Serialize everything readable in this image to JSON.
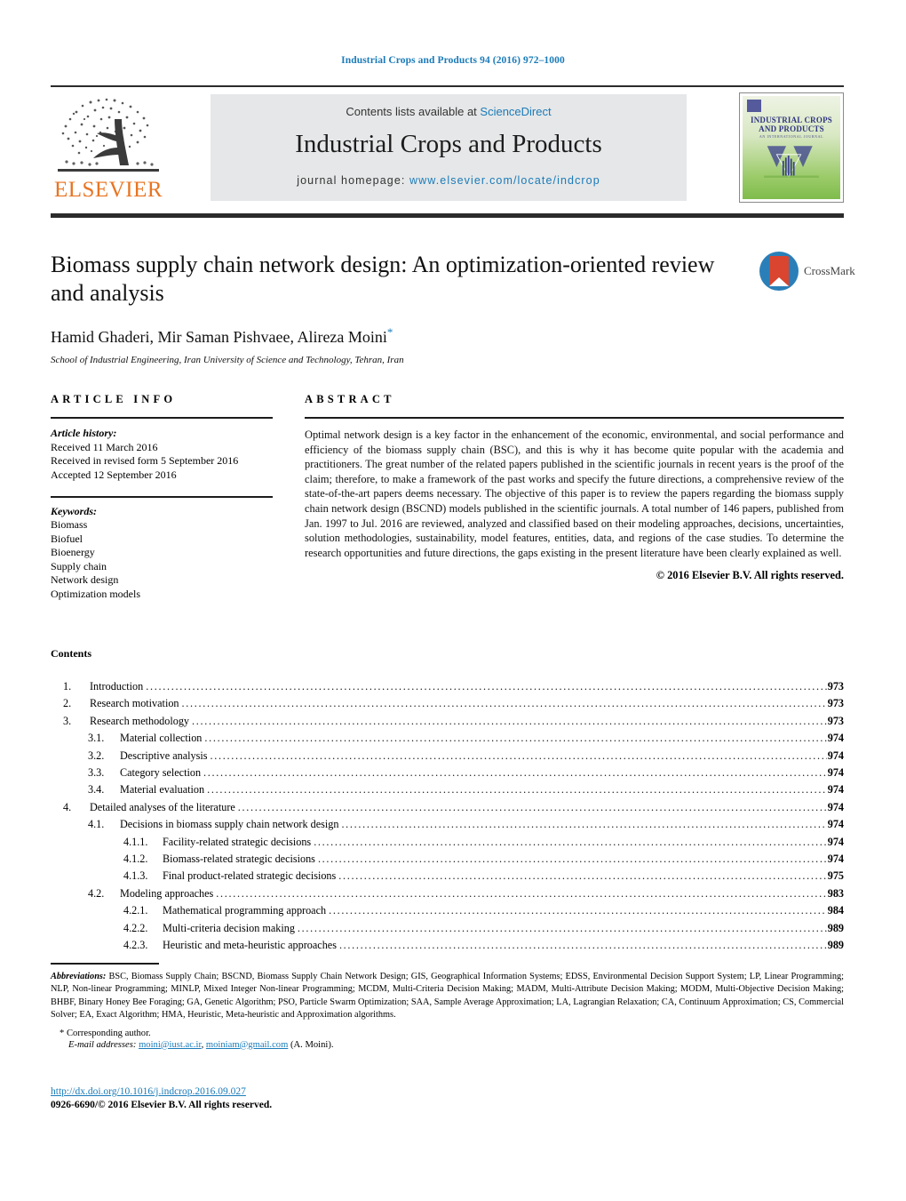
{
  "running_head": "Industrial Crops and Products 94 (2016) 972–1000",
  "masthead": {
    "publisher_name": "ELSEVIER",
    "contents_prefix": "Contents lists available at ",
    "sciencedirect": "ScienceDirect",
    "journal_title": "Industrial Crops and Products",
    "homepage_prefix": "journal homepage: ",
    "homepage_url": "www.elsevier.com/locate/indcrop",
    "cover": {
      "title_line1": "INDUSTRIAL CROPS",
      "title_line2": "AND PRODUCTS",
      "subtitle": "AN INTERNATIONAL JOURNAL"
    },
    "link_color": "#1a7bb9",
    "band_color": "#e6e7e8",
    "elsevier_orange": "#e87422"
  },
  "article": {
    "title": "Biomass supply chain network design: An optimization-oriented review and analysis",
    "authors": "Hamid Ghaderi, Mir Saman Pishvaee, Alireza Moini",
    "corresponding_marker": "*",
    "affiliation": "School of Industrial Engineering, Iran University of Science and Technology, Tehran, Iran",
    "crossmark_label": "CrossMark"
  },
  "article_info": {
    "heading": "ARTICLE INFO",
    "history_label": "Article history:",
    "history": [
      "Received 11 March 2016",
      "Received in revised form 5 September 2016",
      "Accepted 12 September 2016"
    ],
    "keywords_label": "Keywords:",
    "keywords": [
      "Biomass",
      "Biofuel",
      "Bioenergy",
      "Supply chain",
      "Network design",
      "Optimization models"
    ]
  },
  "abstract": {
    "heading": "ABSTRACT",
    "text": "Optimal network design is a key factor in the enhancement of the economic, environmental, and social performance and efficiency of the biomass supply chain (BSC), and this is why it has become quite popular with the academia and practitioners. The great number of the related papers published in the scientific journals in recent years is the proof of the claim; therefore, to make a framework of the past works and specify the future directions, a comprehensive review of the state-of-the-art papers deems necessary. The objective of this paper is to review the papers regarding the biomass supply chain network design (BSCND) models published in the scientific journals. A total number of 146 papers, published from Jan. 1997 to Jul. 2016 are reviewed, analyzed and classified based on their modeling approaches, decisions, uncertainties, solution methodologies, sustainability, model features, entities, data, and regions of the case studies. To determine the research opportunities and future directions, the gaps existing in the present literature have been clearly explained as well.",
    "copyright": "© 2016 Elsevier B.V. All rights reserved."
  },
  "contents": {
    "title": "Contents",
    "entries": [
      {
        "level": 1,
        "num": "1.",
        "label": "Introduction",
        "page": "973"
      },
      {
        "level": 1,
        "num": "2.",
        "label": "Research motivation",
        "page": "973"
      },
      {
        "level": 1,
        "num": "3.",
        "label": "Research methodology",
        "page": "973"
      },
      {
        "level": 2,
        "num": "3.1.",
        "label": "Material collection",
        "page": "974"
      },
      {
        "level": 2,
        "num": "3.2.",
        "label": "Descriptive analysis",
        "page": "974"
      },
      {
        "level": 2,
        "num": "3.3.",
        "label": "Category selection",
        "page": "974"
      },
      {
        "level": 2,
        "num": "3.4.",
        "label": "Material evaluation",
        "page": "974"
      },
      {
        "level": 1,
        "num": "4.",
        "label": "Detailed analyses of the literature",
        "page": "974"
      },
      {
        "level": 2,
        "num": "4.1.",
        "label": "Decisions in biomass supply chain network design",
        "page": "974"
      },
      {
        "level": 3,
        "num": "4.1.1.",
        "label": "Facility-related strategic decisions",
        "page": "974"
      },
      {
        "level": 3,
        "num": "4.1.2.",
        "label": "Biomass-related strategic decisions",
        "page": "974"
      },
      {
        "level": 3,
        "num": "4.1.3.",
        "label": "Final product-related strategic decisions",
        "page": "975"
      },
      {
        "level": 2,
        "num": "4.2.",
        "label": "Modeling approaches",
        "page": "983"
      },
      {
        "level": 3,
        "num": "4.2.1.",
        "label": "Mathematical programming approach",
        "page": "984"
      },
      {
        "level": 3,
        "num": "4.2.2.",
        "label": "Multi-criteria decision making",
        "page": "989"
      },
      {
        "level": 3,
        "num": "4.2.3.",
        "label": "Heuristic and meta-heuristic approaches",
        "page": "989"
      }
    ]
  },
  "footnotes": {
    "abbreviations_label": "Abbreviations:",
    "abbreviations_text": "BSC, Biomass Supply Chain; BSCND, Biomass Supply Chain Network Design; GIS, Geographical Information Systems; EDSS, Environmental Decision Support System; LP, Linear Programming; NLP, Non-linear Programming; MINLP, Mixed Integer Non-linear Programming; MCDM, Multi-Criteria Decision Making; MADM, Multi-Attribute Decision Making; MODM, Multi-Objective Decision Making; BHBF, Binary Honey Bee Foraging; GA, Genetic Algorithm; PSO, Particle Swarm Optimization; SAA, Sample Average Approximation; LA, Lagrangian Relaxation; CA, Continuum Approximation; CS, Commercial Solver; EA, Exact Algorithm; HMA, Heuristic, Meta-heuristic and Approximation algorithms.",
    "corresponding_marker": "*",
    "corresponding_text": "Corresponding author.",
    "email_label": "E-mail addresses:",
    "email_1": "moini@iust.ac.ir",
    "email_sep": ", ",
    "email_2": "moiniam@gmail.com",
    "email_suffix": " (A. Moini).",
    "doi": "http://dx.doi.org/10.1016/j.indcrop.2016.09.027",
    "issn_line": "0926-6690/© 2016 Elsevier B.V. All rights reserved."
  }
}
